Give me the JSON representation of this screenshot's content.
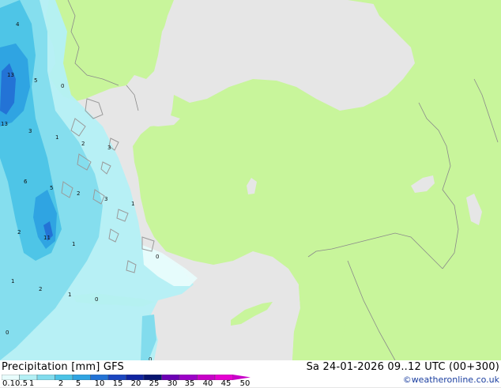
{
  "legend": {
    "title": "Precipitation [mm]",
    "model": "GFS",
    "datetime": "Sa 24-01-2026 09..12 UTC (00+300)",
    "credit": "©weatheronline.co.uk",
    "scale_labels": [
      "0.1",
      "0.5",
      "1",
      "2",
      "5",
      "10",
      "15",
      "20",
      "25",
      "30",
      "35",
      "40",
      "45",
      "50"
    ],
    "scale_colors": [
      "#e8fcfc",
      "#b4f0f5",
      "#82dced",
      "#4bc3e6",
      "#2fa4e2",
      "#2373d6",
      "#1b46c0",
      "#1024a0",
      "#081470",
      "#6c00b4",
      "#9c00c8",
      "#c800c8",
      "#e600d2",
      "#f0a0f0"
    ]
  },
  "map": {
    "colors": {
      "sea": "#e6e6e6",
      "land": "#c8f59b",
      "border": "#8a8a8a",
      "coast": "#9a9a9a"
    },
    "precip_labels": [
      "4",
      "13",
      "5",
      "0",
      "13",
      "3",
      "1",
      "2",
      "3",
      "6",
      "5",
      "2",
      "3",
      "2",
      "1",
      "11",
      "1",
      "0",
      "1",
      "2",
      "1",
      "0",
      "0",
      "0"
    ]
  }
}
